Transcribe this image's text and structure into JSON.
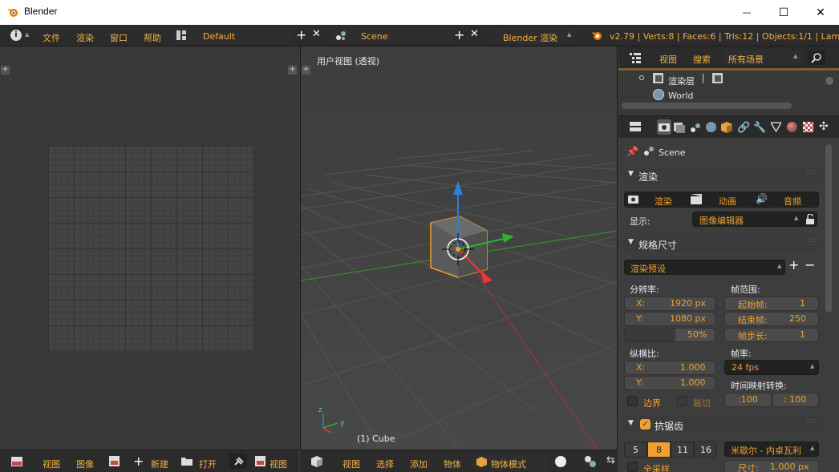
{
  "window": {
    "title": "Blender",
    "minimize": "—",
    "maximize": "☐",
    "close": "✕"
  },
  "infobar": {
    "menus": [
      "文件",
      "渲染",
      "窗口",
      "帮助"
    ],
    "layout": "Default",
    "scene": "Scene",
    "engine": "Blender 渲染",
    "stats": "v2.79 | Verts:8 | Faces:6 | Tris:12 | Objects:1/1 | Lamps:0"
  },
  "image_editor": {
    "footer": {
      "view": "视图",
      "image": "图像",
      "new": "新建",
      "open": "打开",
      "view2": "视图"
    }
  },
  "viewport": {
    "title": "用户视图 (透视)",
    "object_label": "(1) Cube",
    "footer": {
      "view": "视图",
      "select": "选择",
      "add": "添加",
      "object": "物体",
      "mode": "物体模式"
    }
  },
  "outliner": {
    "view": "视图",
    "search": "搜索",
    "filter": "所有场景",
    "items": [
      "渲染层",
      "World"
    ]
  },
  "properties": {
    "scene": "Scene",
    "render_panel": {
      "title": "渲染",
      "buttons": [
        "渲染",
        "动画",
        "音频"
      ],
      "display_label": "显示:",
      "display_value": "图像编辑器"
    },
    "dimensions_panel": {
      "title": "规格尺寸",
      "preset": "渲染预设",
      "resolution_label": "分辨率:",
      "res_x_label": "X:",
      "res_x": "1920 px",
      "res_y_label": "Y:",
      "res_y": "1080 px",
      "res_pct": "50%",
      "frame_range_label": "帧范围:",
      "start_label": "起始帧:",
      "start": "1",
      "end_label": "结束帧:",
      "end": "250",
      "step_label": "帧步长:",
      "step": "1",
      "aspect_label": "纵横比:",
      "asp_x_label": "X:",
      "asp_x": "1.000",
      "asp_y_label": "Y:",
      "asp_y": "1.000",
      "frame_rate_label": "帧率:",
      "frame_rate": "24 fps",
      "time_remap_label": "时间映射转换:",
      "remap_old": ":100",
      "remap_new": ": 100",
      "border": "边界",
      "crop": "裁切"
    },
    "aa_panel": {
      "title": "抗锯齿",
      "samples": [
        "5",
        "8",
        "11",
        "16"
      ],
      "selected_sample": "8",
      "filter": "米歇尔 - 内卓瓦利",
      "full_sample": "全采样",
      "size_label": "尺寸:",
      "size": "1.000 px"
    }
  },
  "colors": {
    "accent": "#f0a030",
    "bg": "#3d3d3d",
    "header": "#2b2b2b"
  }
}
